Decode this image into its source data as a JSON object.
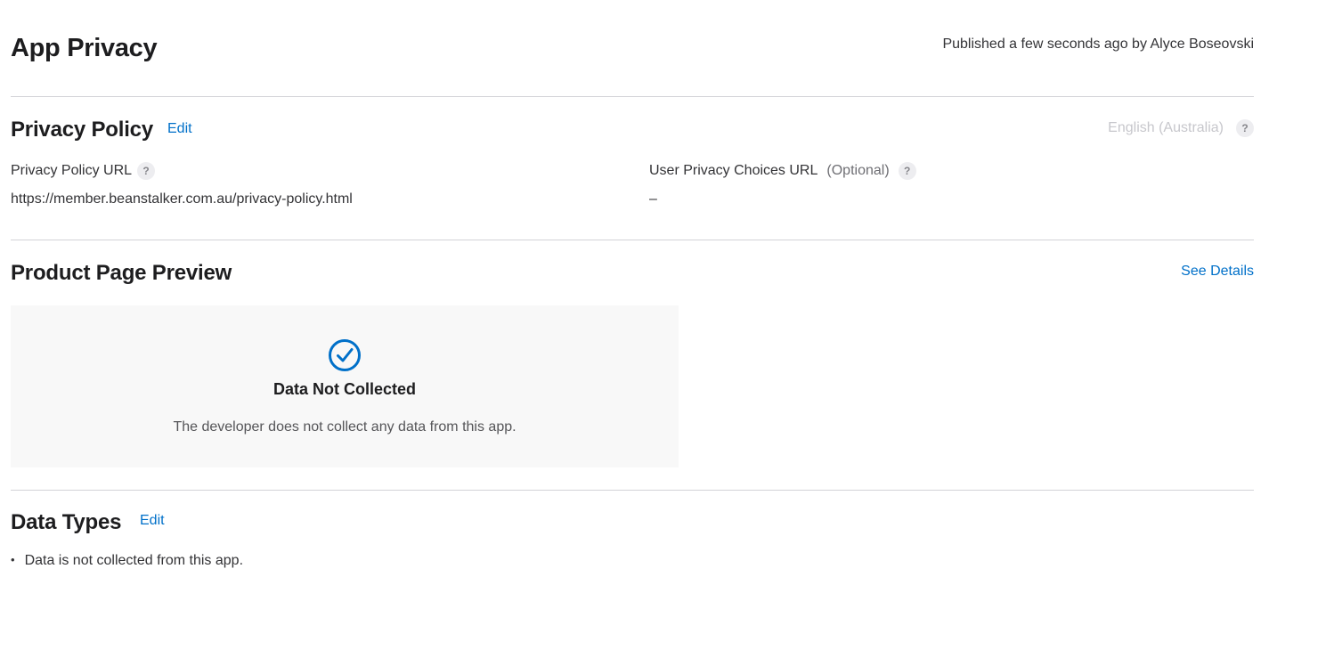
{
  "header": {
    "title": "App Privacy",
    "published_text": "Published a few seconds ago by Alyce Boseovski"
  },
  "privacy_policy": {
    "title": "Privacy Policy",
    "edit_label": "Edit",
    "language": "English (Australia)",
    "help_glyph": "?",
    "policy_url_label": "Privacy Policy URL",
    "policy_url_value": "https://member.beanstalker.com.au/privacy-policy.html",
    "choices_url_label": "User Privacy Choices URL",
    "choices_url_optional": "(Optional)",
    "choices_url_value": "–"
  },
  "product_page_preview": {
    "title": "Product Page Preview",
    "see_details_label": "See Details",
    "card": {
      "icon": "checkmark-circle-icon",
      "title": "Data Not Collected",
      "text": "The developer does not collect any data from this app."
    }
  },
  "data_types": {
    "title": "Data Types",
    "edit_label": "Edit",
    "items": [
      "Data is not collected from this app."
    ]
  },
  "colors": {
    "link": "#0070c9",
    "divider": "#d2d2d7",
    "card_background": "#f8f8f8"
  }
}
